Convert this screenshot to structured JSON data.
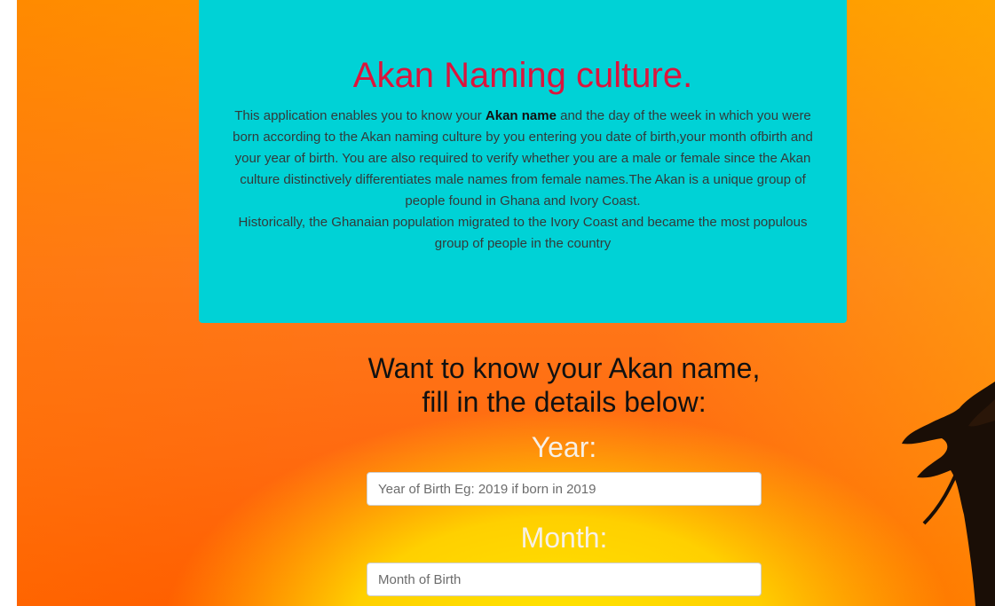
{
  "header": {
    "title": "Akan Naming culture.",
    "intro_before_bold": "This application enables you to know your ",
    "intro_bold": "Akan name",
    "intro_after_bold": " and the day of the week in which you were born according to the Akan naming culture by you entering you date of birth,your month ofbirth and your year of birth. You are also required to verify whether you are a male or female since the Akan culture distinctively differentiates male names from female names.The Akan is a unique group of people found in Ghana and Ivory Coast.",
    "history": "Historically, the Ghanaian population migrated to the Ivory Coast and became the most populous group of people in the country"
  },
  "form": {
    "prompt_line1": "Want to know your Akan name,",
    "prompt_line2": "fill in the details below:",
    "year_label": "Year:",
    "year_placeholder": "Year of Birth Eg: 2019 if born in 2019",
    "month_label": "Month:",
    "month_placeholder": "Month of Birth"
  },
  "background": {
    "icon": "acacia-tree-silhouette",
    "colors": {
      "card": "#00d2d6",
      "title": "#dc143c",
      "sky_top": "#ff9400",
      "sun": "#ffe600"
    }
  }
}
